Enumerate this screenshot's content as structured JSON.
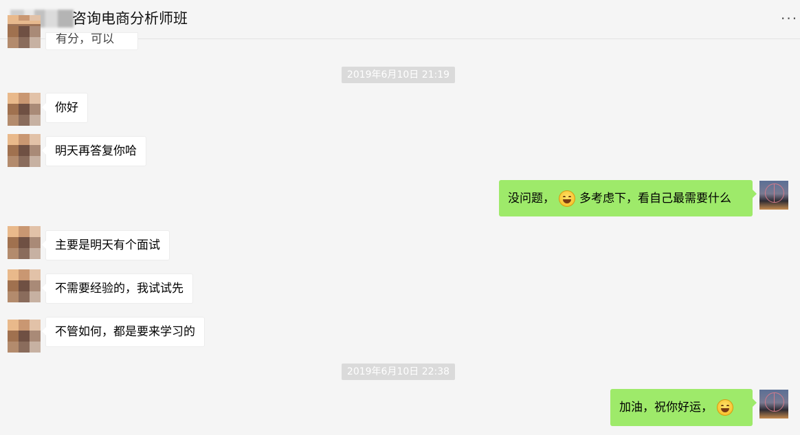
{
  "header": {
    "title": "咨询电商分析师班",
    "more_icon": "more-dots-icon",
    "more_glyph": "···"
  },
  "chat": {
    "partial_message": "有分，可以",
    "messages": [
      {
        "type": "timestamp",
        "text": "2019年6月10日 21:19"
      },
      {
        "type": "received",
        "text": "你好"
      },
      {
        "type": "received",
        "text": "明天再答复你哈"
      },
      {
        "type": "sent",
        "text_before": "没问题，",
        "emoji": "grinning-face-emoji",
        "text_after": "多考虑下，看自己最需要什么"
      },
      {
        "type": "received",
        "text": "主要是明天有个面试"
      },
      {
        "type": "received",
        "text": "不需要经验的，我试试先"
      },
      {
        "type": "received",
        "text": "不管如何，都是要来学习的"
      },
      {
        "type": "timestamp",
        "text": "2019年6月10日 22:38"
      },
      {
        "type": "sent",
        "text_before": "加油，祝你好运，",
        "emoji": "grinning-face-emoji",
        "text_after": ""
      }
    ]
  },
  "colors": {
    "background": "#f5f5f5",
    "sent_bubble": "#9eea6a",
    "received_bubble": "#ffffff",
    "timestamp_bg": "#dadada"
  }
}
